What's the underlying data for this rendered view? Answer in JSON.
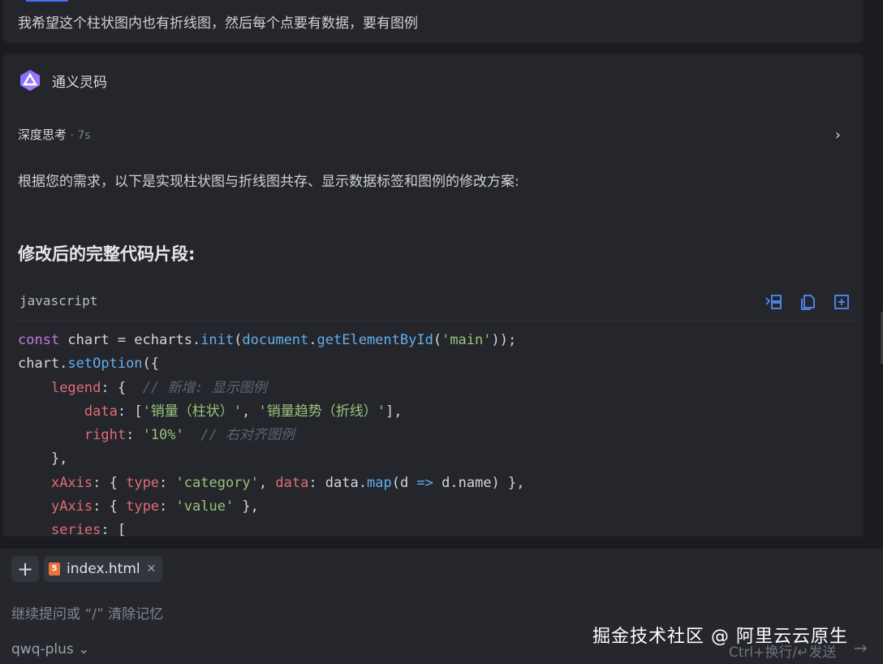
{
  "user_message": {
    "text": "我希望这个柱状图内也有折线图，然后每个点要有数据，要有图例"
  },
  "assistant": {
    "name": "通义灵码",
    "thinking": {
      "label": "深度思考",
      "time": " · 7s"
    },
    "intro": "根据您的需求，以下是实现柱状图与折线图共存、显示数据标签和图例的修改方案:",
    "section_title": "修改后的完整代码片段:",
    "code": {
      "language": "javascript",
      "tools": [
        "insert-icon",
        "copy-icon",
        "new-file-icon"
      ]
    }
  },
  "input": {
    "file_chip": "index.html",
    "placeholder": "继续提问或 “/” 清除记忆",
    "model": "qwq-plus",
    "send_hint": "Ctrl+换行/↵发送"
  },
  "watermark": "掘金技术社区 @ 阿里云云原生",
  "colors": {
    "background": "#1b1c21",
    "panel": "#25262c",
    "accent": "#4d6bfe",
    "icon_blue": "#4f8cf7"
  }
}
